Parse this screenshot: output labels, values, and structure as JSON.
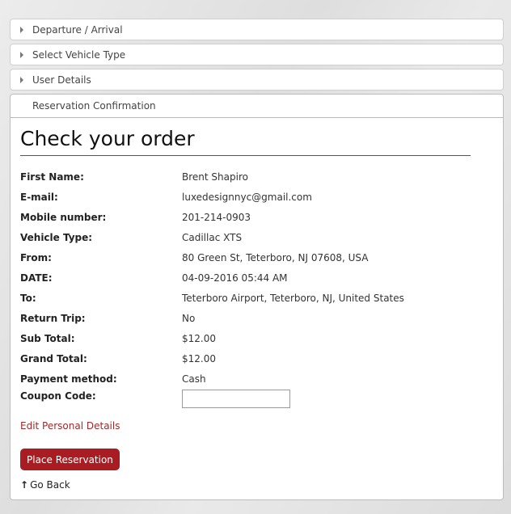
{
  "accordion": {
    "sections": [
      {
        "label": "Departure / Arrival"
      },
      {
        "label": "Select Vehicle Type"
      },
      {
        "label": "User Details"
      }
    ],
    "active": {
      "label": "Reservation Confirmation"
    }
  },
  "order": {
    "title": "Check your order",
    "rows": [
      {
        "label": "First Name:",
        "value": "Brent Shapiro"
      },
      {
        "label": "E-mail:",
        "value": "luxedesignnyc@gmail.com"
      },
      {
        "label": "Mobile number:",
        "value": "201-214-0903"
      },
      {
        "label": "Vehicle Type:",
        "value": "Cadillac XTS"
      },
      {
        "label": "From:",
        "value": "80 Green St, Teterboro, NJ 07608, USA"
      },
      {
        "label": "DATE:",
        "value": "04-09-2016 05:44 AM"
      },
      {
        "label": "To:",
        "value": "Teterboro Airport, Teterboro, NJ, United States"
      },
      {
        "label": "Return Trip:",
        "value": "No"
      },
      {
        "label": "Sub Total:",
        "value": "$12.00"
      },
      {
        "label": "Grand Total:",
        "value": "$12.00"
      },
      {
        "label": "Payment method:",
        "value": "Cash"
      }
    ],
    "coupon": {
      "label": "Coupon Code:",
      "value": "",
      "placeholder": ""
    }
  },
  "actions": {
    "edit_label": "Edit Personal Details",
    "place_label": "Place Reservation",
    "back_label": "Go Back"
  },
  "colors": {
    "accent": "#a81c22",
    "link": "#9b2a2a"
  }
}
